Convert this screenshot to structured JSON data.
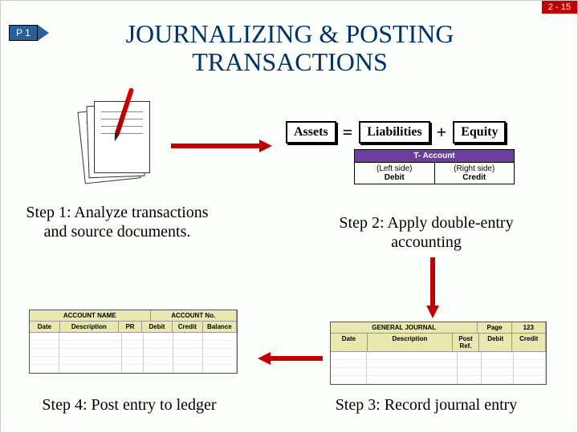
{
  "page_number": "2 - 15",
  "badge": "P 1",
  "title": "JOURNALIZING & POSTING TRANSACTIONS",
  "equation": {
    "left": "Assets",
    "op1": "=",
    "mid": "Liabilities",
    "op2": "+",
    "right": "Equity"
  },
  "t_account": {
    "title": "T- Account",
    "left_side": "(Left side)",
    "left_label": "Debit",
    "right_side": "(Right side)",
    "right_label": "Credit"
  },
  "steps": {
    "s1": "Step 1: Analyze transactions and source documents.",
    "s2": "Step 2: Apply double-entry accounting",
    "s3": "Step 3: Record journal entry",
    "s4": "Step 4: Post entry to ledger"
  },
  "ledger": {
    "title_left": "ACCOUNT NAME",
    "title_right": "ACCOUNT No.",
    "cols": [
      "Date",
      "Description",
      "PR",
      "Debit",
      "Credit",
      "Balance"
    ]
  },
  "journal": {
    "title_left": "GENERAL JOURNAL",
    "page_label": "Page",
    "page_no": "123",
    "cols": [
      "Date",
      "Description",
      "Post Ref.",
      "Debit",
      "Credit"
    ]
  }
}
